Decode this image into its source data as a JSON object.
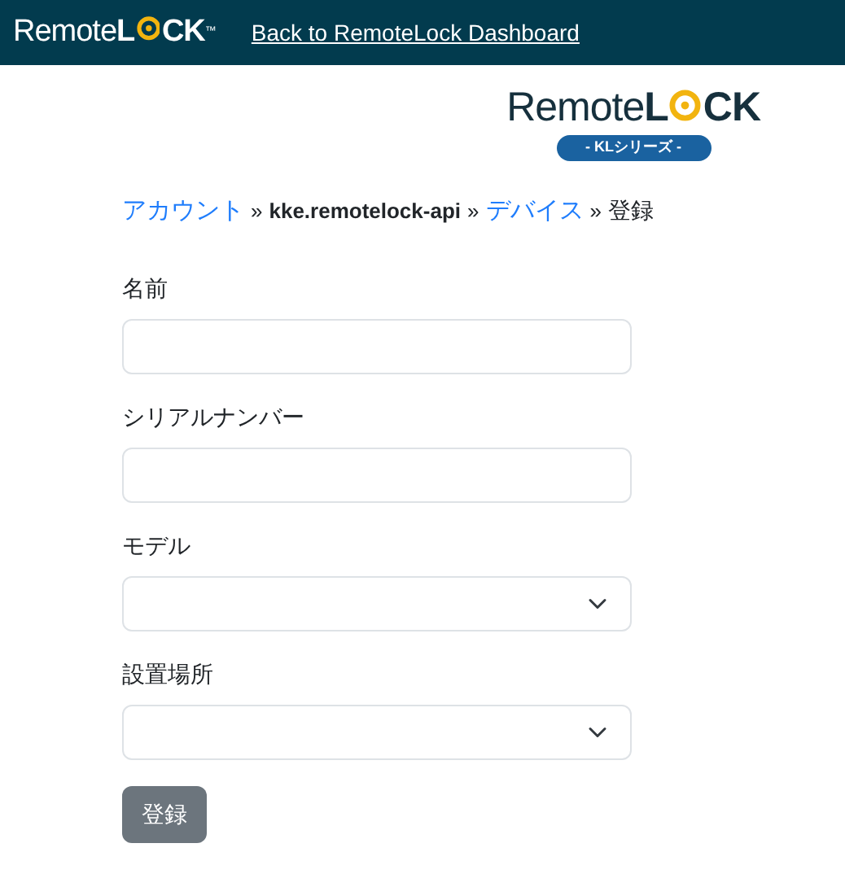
{
  "header": {
    "logo": {
      "before": "Remote",
      "mid": "L",
      "after": "CK",
      "mark": "™"
    },
    "link": "Back to RemoteLock Dashboard"
  },
  "brand": {
    "before": "Remote",
    "mid": "L",
    "after": "CK",
    "tag": "- KLシリーズ -"
  },
  "breadcrumb": [
    {
      "text": "アカウント",
      "kind": "link"
    },
    {
      "text": "»",
      "kind": "sep"
    },
    {
      "text": "kke.remotelock-api",
      "kind": "strong"
    },
    {
      "text": "»",
      "kind": "sep"
    },
    {
      "text": "デバイス",
      "kind": "link"
    },
    {
      "text": "»",
      "kind": "sep"
    },
    {
      "text": "登録",
      "kind": "current"
    }
  ],
  "fields": [
    {
      "label": "名前",
      "kind": "text"
    },
    {
      "label": "シリアルナンバー",
      "kind": "text"
    },
    {
      "label": "モデル",
      "kind": "select"
    },
    {
      "label": "設置場所",
      "kind": "select"
    }
  ],
  "submit": {
    "label": "登録",
    "disabled": true
  }
}
